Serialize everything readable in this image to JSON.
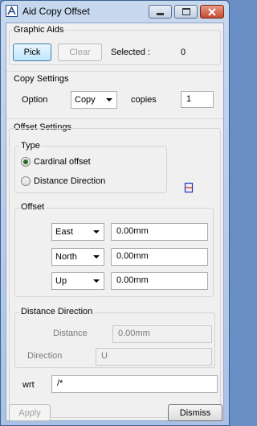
{
  "window": {
    "title": "Aid Copy Offset",
    "accent": "#3b5f93"
  },
  "graphic_aids": {
    "legend": "Graphic Aids",
    "pick_label": "Pick",
    "clear_label": "Clear",
    "selected_label": "Selected :",
    "selected_count": "0"
  },
  "copy_settings": {
    "legend": "Copy Settings",
    "option_label": "Option",
    "option_value": "Copy",
    "copies_label": "copies",
    "copies_value": "1"
  },
  "offset_settings": {
    "legend": "Offset Settings",
    "type": {
      "legend": "Type",
      "options": [
        {
          "label": "Cardinal offset",
          "selected": true
        },
        {
          "label": "Distance  Direction",
          "selected": false
        }
      ]
    },
    "offset": {
      "legend": "Offset",
      "rows": [
        {
          "direction": "East",
          "value": "0.00mm"
        },
        {
          "direction": "North",
          "value": "0.00mm"
        },
        {
          "direction": "Up",
          "value": "0.00mm"
        }
      ]
    },
    "distance_direction": {
      "legend": "Distance Direction",
      "distance_label": "Distance",
      "distance_value": "0.00mm",
      "direction_label": "Direction",
      "direction_value": "U"
    },
    "wrt_label": "wrt",
    "wrt_value": "/*"
  },
  "footer": {
    "apply_label": "Apply",
    "dismiss_label": "Dismiss"
  }
}
